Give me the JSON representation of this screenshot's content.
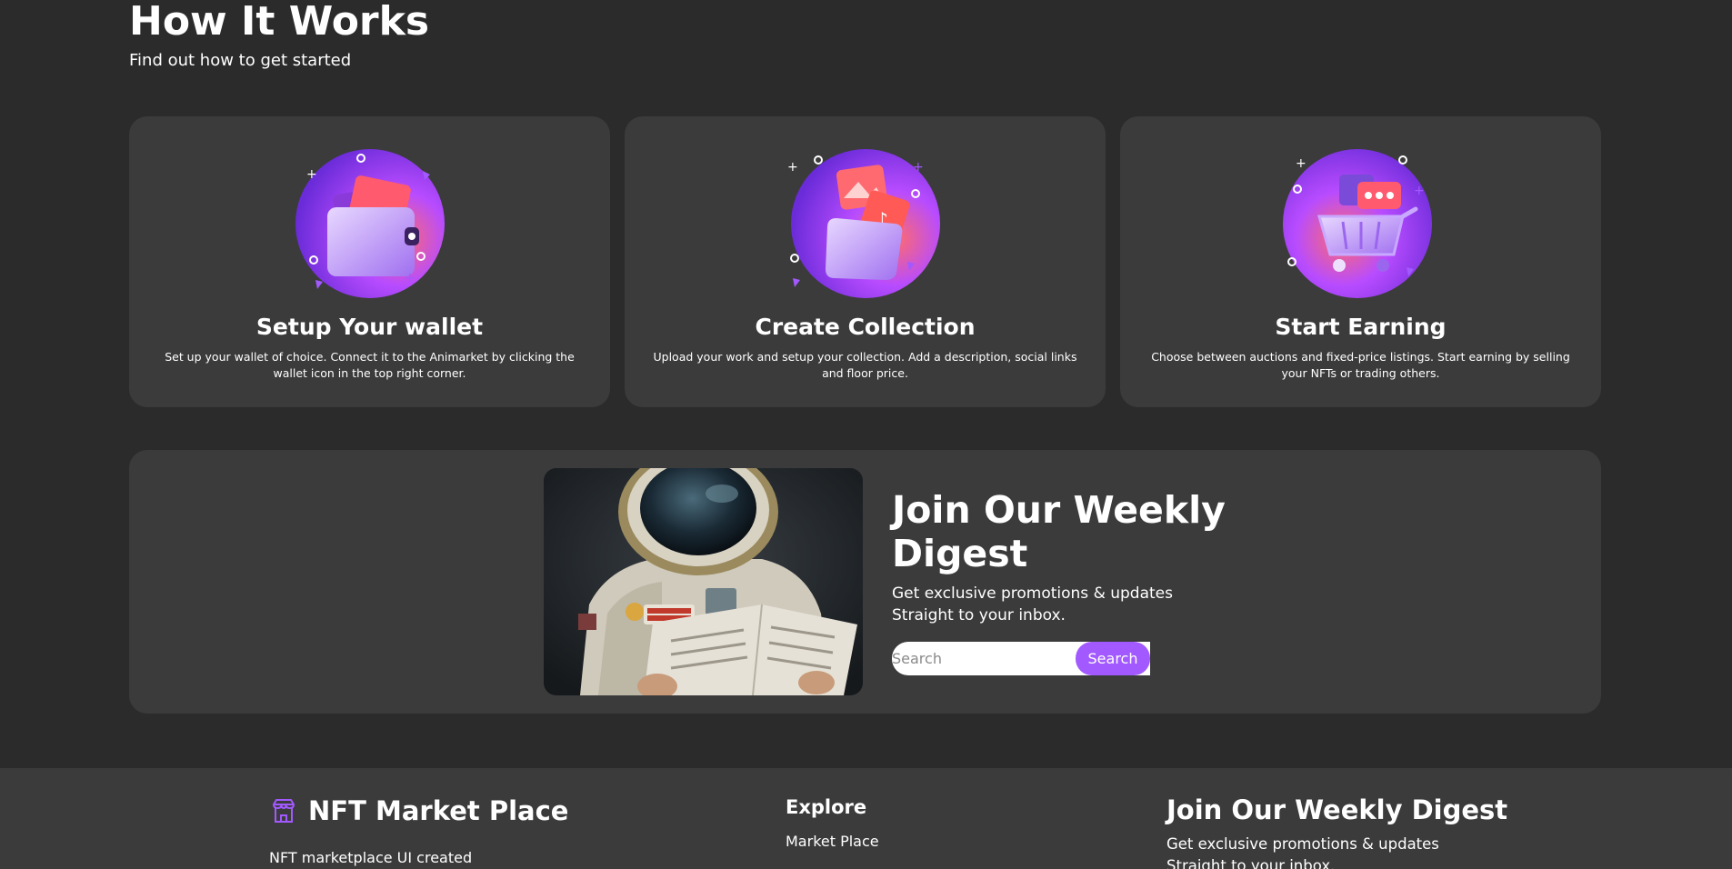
{
  "how_it_works": {
    "title": "How It Works",
    "subtitle": "Find out how to get started"
  },
  "cards": [
    {
      "title": "Setup Your wallet",
      "description": "Set up your wallet of choice. Connect it to the Animarket by clicking the wallet icon in the top right corner.",
      "icon": "wallet-icon"
    },
    {
      "title": "Create Collection",
      "description": "Upload your work and setup your collection. Add a description, social links and floor price.",
      "icon": "folder-media-icon"
    },
    {
      "title": "Start Earning",
      "description": "Choose between auctions and fixed-price listings. Start earning by selling your NFTs or trading others.",
      "icon": "shopping-cart-icon"
    }
  ],
  "newsletter": {
    "title": "Join Our Weekly Digest",
    "subtitle_line1": "Get exclusive promotions & updates",
    "subtitle_line2": "Straight to your inbox.",
    "input_placeholder": "Search",
    "button_label": "Search",
    "image": "astronaut-reading-newspaper"
  },
  "footer": {
    "brand_name": "NFT Market Place",
    "brand_icon": "storefront-icon",
    "brand_desc": "NFT marketplace UI created",
    "explore_title": "Explore",
    "explore_links": [
      "Market Place"
    ],
    "digest_title": "Join Our Weekly Digest",
    "digest_line1": "Get exclusive promotions & updates",
    "digest_line2": "Straight to your inbox."
  },
  "colors": {
    "background": "#2b2b2b",
    "card": "#3b3b3b",
    "accent": "#a259ff",
    "text": "#ffffff"
  }
}
